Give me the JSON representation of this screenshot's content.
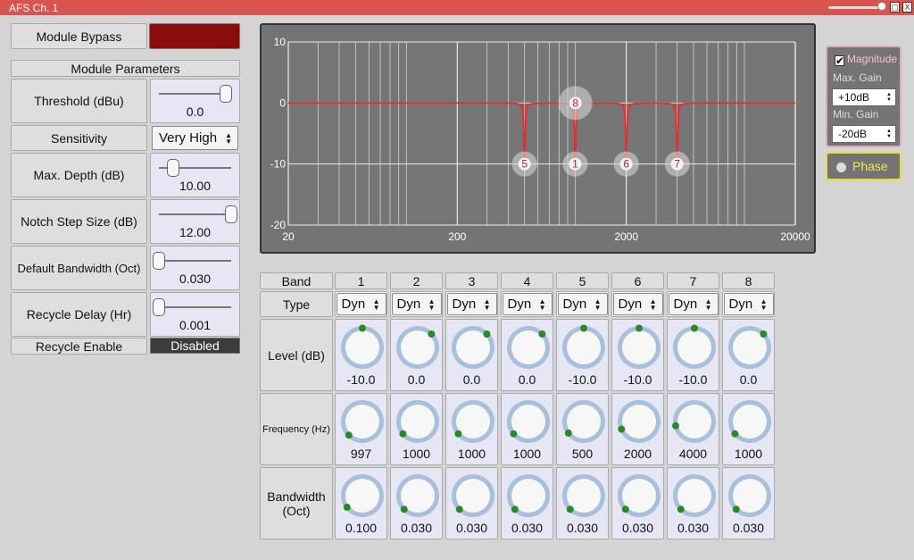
{
  "window": {
    "title": "AFS Ch. 1"
  },
  "left": {
    "bypass_label": "Module Bypass",
    "params_title": "Module Parameters",
    "threshold": {
      "label": "Threshold (dBu)",
      "value": "0.0",
      "level": 0.93
    },
    "sensitivity": {
      "label": "Sensitivity",
      "value": "Very High"
    },
    "max_depth": {
      "label": "Max. Depth (dB)",
      "value": "10.00",
      "level": 0.2
    },
    "notch_step": {
      "label": "Notch Step Size (dB)",
      "value": "12.00",
      "level": 1.0
    },
    "default_bw": {
      "label": "Default Bandwidth (Oct)",
      "value": "0.030",
      "level": 0.0
    },
    "recycle_delay": {
      "label": "Recycle Delay (Hr)",
      "value": "0.001",
      "level": 0.0
    },
    "recycle_enable": {
      "label": "Recycle Enable",
      "value": "Disabled"
    }
  },
  "graph": {
    "y_ticks": [
      "10",
      "0",
      "-10",
      "-20"
    ],
    "x_ticks": [
      "20",
      "200",
      "2000",
      "20000"
    ],
    "x_min": 20,
    "x_max": 20000,
    "y_min": -20,
    "y_max": 10,
    "curve_color": "#e03030",
    "markers": [
      {
        "label": "8",
        "freq": 1000,
        "db": 0,
        "large": true
      },
      {
        "label": "5",
        "freq": 500,
        "db": -10
      },
      {
        "label": "1",
        "freq": 997,
        "db": -10
      },
      {
        "label": "6",
        "freq": 2000,
        "db": -10
      },
      {
        "label": "7",
        "freq": 4000,
        "db": -10
      }
    ]
  },
  "options": {
    "magnitude_label": "Magnitude",
    "magnitude_checked": "✔",
    "max_gain_label": "Max. Gain",
    "max_gain_value": "+10dB",
    "min_gain_label": "Min. Gain",
    "min_gain_value": "-20dB",
    "phase_label": "Phase"
  },
  "bands": {
    "header_label": "Band",
    "type_label": "Type",
    "level_label": "Level (dB)",
    "freq_label": "Frequency (Hz)",
    "bw_label": "Bandwidth (Oct)",
    "numbers": [
      "1",
      "2",
      "3",
      "4",
      "5",
      "6",
      "7",
      "8"
    ],
    "types": [
      "Dyn",
      "Dyn",
      "Dyn",
      "Dyn",
      "Dyn",
      "Dyn",
      "Dyn",
      "Dyn"
    ],
    "levels": [
      "-10.0",
      "0.0",
      "0.0",
      "0.0",
      "-10.0",
      "-10.0",
      "-10.0",
      "0.0"
    ],
    "level_knob": [
      0.5,
      0.67,
      0.67,
      0.67,
      0.5,
      0.5,
      0.5,
      0.67
    ],
    "freqs": [
      "997",
      "1000",
      "1000",
      "1000",
      "500",
      "2000",
      "4000",
      "1000"
    ],
    "freq_knob": [
      0.0,
      0.02,
      0.02,
      0.02,
      0.03,
      0.08,
      0.12,
      0.02
    ],
    "bws": [
      "0.100",
      "0.030",
      "0.030",
      "0.030",
      "0.030",
      "0.030",
      "0.030",
      "0.030"
    ],
    "bw_knob": [
      0.03,
      0.0,
      0.0,
      0.0,
      0.0,
      0.0,
      0.0,
      0.0
    ],
    "knob_dot_color": "#2a8a2a",
    "knob_ring_color": "#a8c0dc"
  }
}
